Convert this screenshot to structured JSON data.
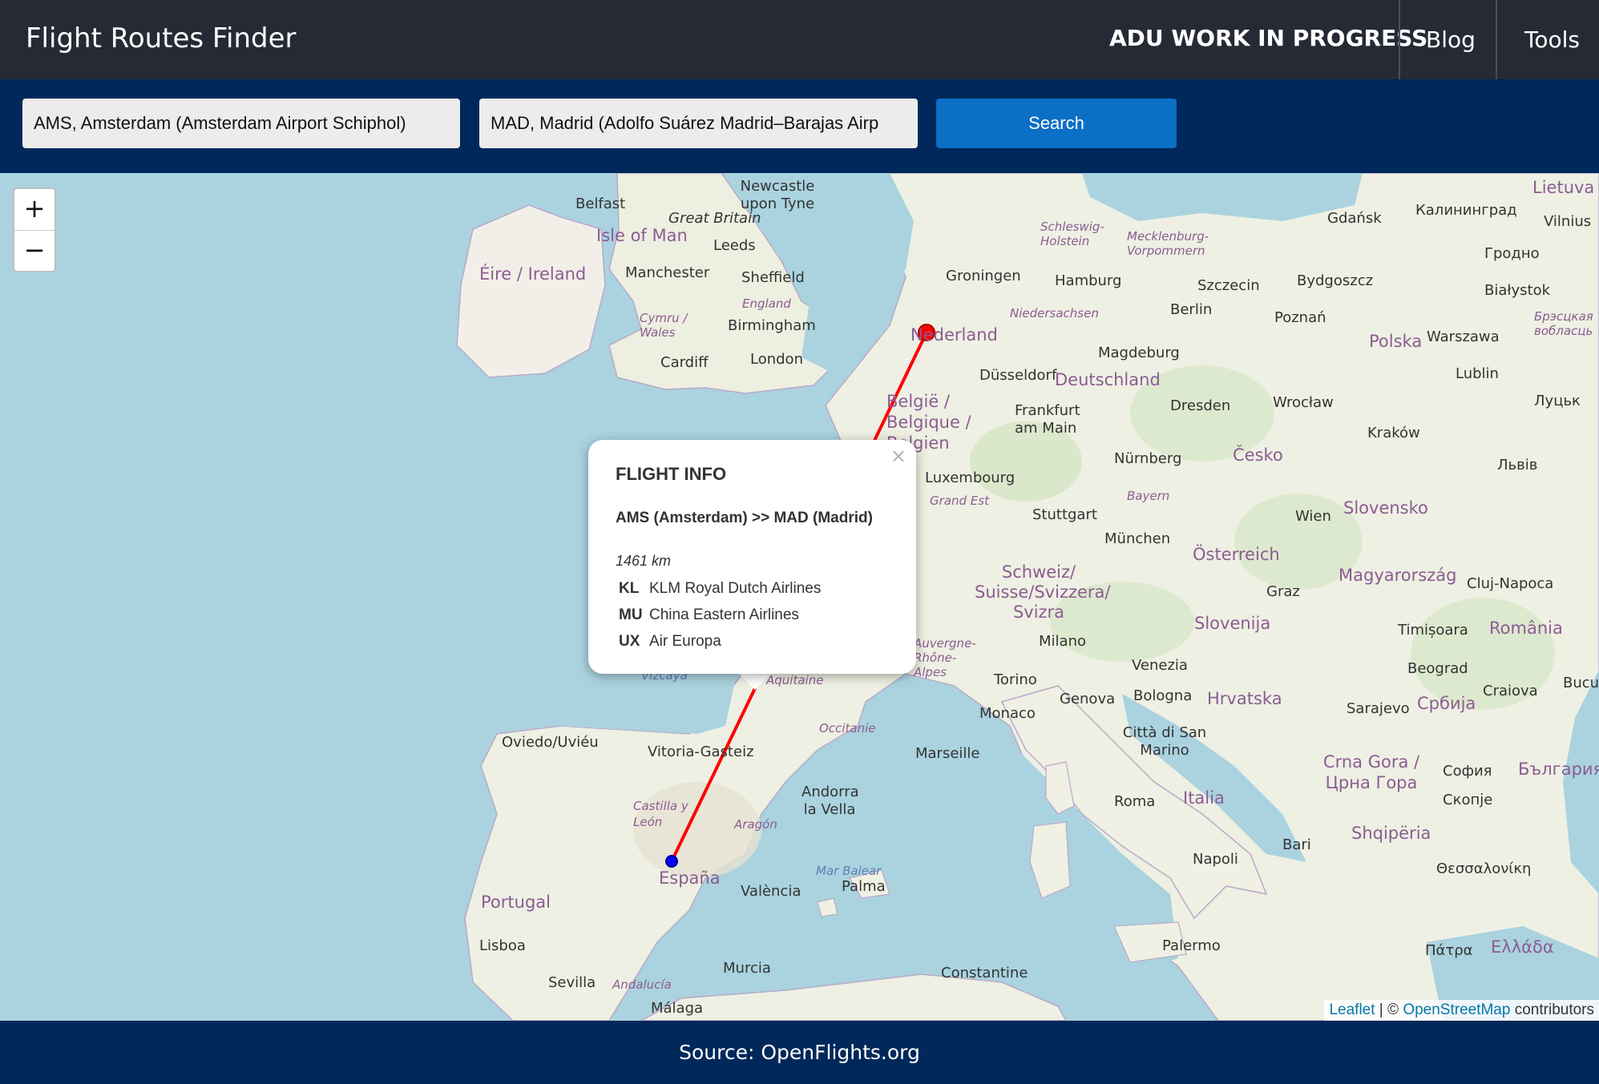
{
  "header": {
    "brand": "Flight Routes Finder",
    "nav": [
      "ADU WORK IN PROGRESS",
      "Blog",
      "Tools"
    ]
  },
  "search": {
    "origin_value": "AMS, Amsterdam (Amsterdam Airport Schiphol)",
    "destination_value": "MAD, Madrid (Adolfo Suárez Madrid–Barajas Airp",
    "button_label": "Search",
    "colors": {
      "bar": "#00285a",
      "button": "#0b6fc5"
    }
  },
  "map": {
    "zoom_in": "+",
    "zoom_out": "−",
    "route_color": "#ff0000",
    "origin_marker_color": "#ff0000",
    "destination_marker_color": "#0000ff",
    "labels": {
      "belfast": "Belfast",
      "newcastle": "Newcastle upon Tyne",
      "great_britain": "Great Britain",
      "isle_of_man": "Isle of Man",
      "eire": "Éire / Ireland",
      "leeds": "Leeds",
      "manchester": "Manchester",
      "sheffield": "Sheffield",
      "england": "England",
      "cymru": "Cymru / Wales",
      "birmingham": "Birmingham",
      "cardiff": "Cardiff",
      "london": "London",
      "groningen": "Groningen",
      "nederland": "Nederland",
      "hamburg": "Hamburg",
      "schleswig": "Schleswig-Holstein",
      "mecklenburg": "Mecklenburg-Vorpommern",
      "niedersachsen": "Niedersachsen",
      "berlin": "Berlin",
      "szczecin": "Szczecin",
      "gdansk": "Gdańsk",
      "kaliningrad": "Калининград",
      "lietuva": "Lietuva",
      "vilnius": "Vilnius",
      "bydgoszcz": "Bydgoszcz",
      "grodno": "Гродно",
      "bialystok": "Białystok",
      "poznan": "Poznań",
      "polska": "Polska",
      "warszawa": "Warszawa",
      "brest": "Брэсцкая вобласць",
      "dusseldorf": "Düsseldorf",
      "magdeburg": "Magdeburg",
      "deutschland": "Deutschland",
      "belgie": "België / Belgique / Belgien",
      "frankfurt": "Frankfurt am Main",
      "dresden": "Dresden",
      "wroclaw": "Wrocław",
      "lublin": "Lublin",
      "lutsk": "Луцьк",
      "krakow": "Kraków",
      "lviv": "Львів",
      "luxembourg": "Luxembourg",
      "nurnberg": "Nürnberg",
      "cesko": "Česko",
      "grand_est": "Grand Est",
      "bayern": "Bayern",
      "stuttgart": "Stuttgart",
      "wien": "Wien",
      "slovensko": "Slovensko",
      "munchen": "München",
      "osterreich": "Österreich",
      "schweiz": "Schweiz/ Suisse/Svizzera/ Svizra",
      "magyarorszag": "Magyarország",
      "cluj": "Cluj-Napoca",
      "graz": "Graz",
      "slovenija": "Slovenija",
      "milano": "Milano",
      "timisoara": "Timișoara",
      "romania": "România",
      "auvergne": "Auvergne-Rhône-Alpes",
      "venezia": "Venezia",
      "torino": "Torino",
      "beograd": "Beograd",
      "genova": "Genova",
      "bologna": "Bologna",
      "hrvatska": "Hrvatska",
      "craiova": "Craiova",
      "bucuresti": "Bucure",
      "aquitaine": "Aquitaine",
      "vizcaya": "Vizcaya",
      "monaco": "Monaco",
      "sarajevo": "Sarajevo",
      "srbija": "Србија",
      "occitanie": "Occitanie",
      "oviedo": "Oviedo/Uviéu",
      "vitoria": "Vitoria-Gasteiz",
      "marseille": "Marseille",
      "san_marino": "Città di San Marino",
      "crna_gora": "Crna Gora / Црна Гора",
      "sofia": "София",
      "bulgaria": "България",
      "andorra": "Andorra la Vella",
      "roma": "Roma",
      "italia": "Italia",
      "skopje": "Скопје",
      "castilla": "Castilla y León",
      "aragon": "Aragón",
      "shqiperia": "Shqipëria",
      "bari": "Bari",
      "napoli": "Napoli",
      "espana": "España",
      "mar_balear": "Mar Balear",
      "palma": "Palma",
      "valencia": "València",
      "thessaloniki": "Θεσσαλονίκη",
      "portugal": "Portugal",
      "lisboa": "Lisboa",
      "murcia": "Murcia",
      "palermo": "Palermo",
      "patra": "Πάτρα",
      "ellada": "Ελλάδα",
      "sevilla": "Sevilla",
      "andalucia": "Andalucía",
      "constantine": "Constantine",
      "malaga": "Málaga"
    },
    "attribution": {
      "leaflet": "Leaflet",
      "sep": " | © ",
      "osm": "OpenStreetMap",
      "suffix": " contributors"
    }
  },
  "popup": {
    "close": "×",
    "title": "FLIGHT INFO",
    "route": "AMS (Amsterdam) >> MAD (Madrid)",
    "distance": "1461 km",
    "airlines": [
      {
        "code": "KL",
        "name": "KLM Royal Dutch Airlines"
      },
      {
        "code": "MU",
        "name": "China Eastern Airlines"
      },
      {
        "code": "UX",
        "name": "Air Europa"
      }
    ]
  },
  "footer": {
    "source": "Source: OpenFlights.org"
  }
}
